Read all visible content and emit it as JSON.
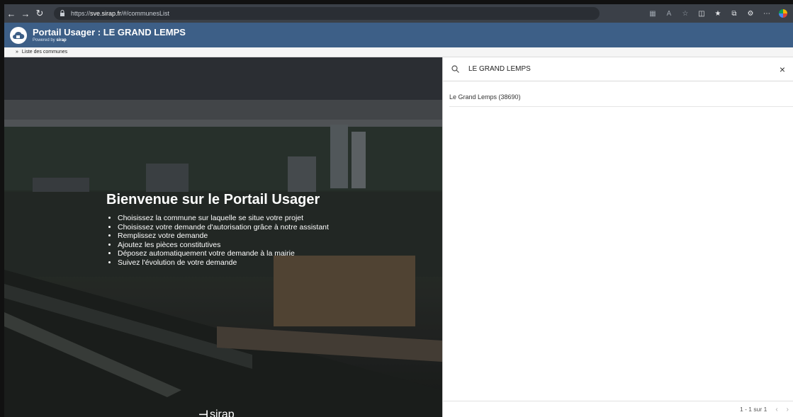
{
  "browser": {
    "url_prefix": "https://",
    "url_host": "sve.sirap.fr",
    "url_path": "/#/communesList"
  },
  "header": {
    "title": "Portail Usager : LE GRAND LEMPS",
    "powered_prefix": "Powered by",
    "powered_brand": "sirap"
  },
  "breadcrumb": {
    "item": "Liste des communes"
  },
  "hero": {
    "title": "Bienvenue sur le Portail Usager",
    "steps": [
      "Choisissez la commune sur laquelle se situe votre projet",
      "Choisissez votre demande d'autorisation grâce à notre assistant",
      "Remplissez votre demande",
      "Ajoutez les pièces constitutives",
      "Déposez automatiquement votre demande à la mairie",
      "Suivez l'évolution de votre demande"
    ],
    "brand": "sirap"
  },
  "search": {
    "value": "LE GRAND LEMPS"
  },
  "results": [
    {
      "label": "Le Grand Lemps (38690)"
    }
  ],
  "pagination": {
    "range": "1 - 1 sur 1"
  }
}
